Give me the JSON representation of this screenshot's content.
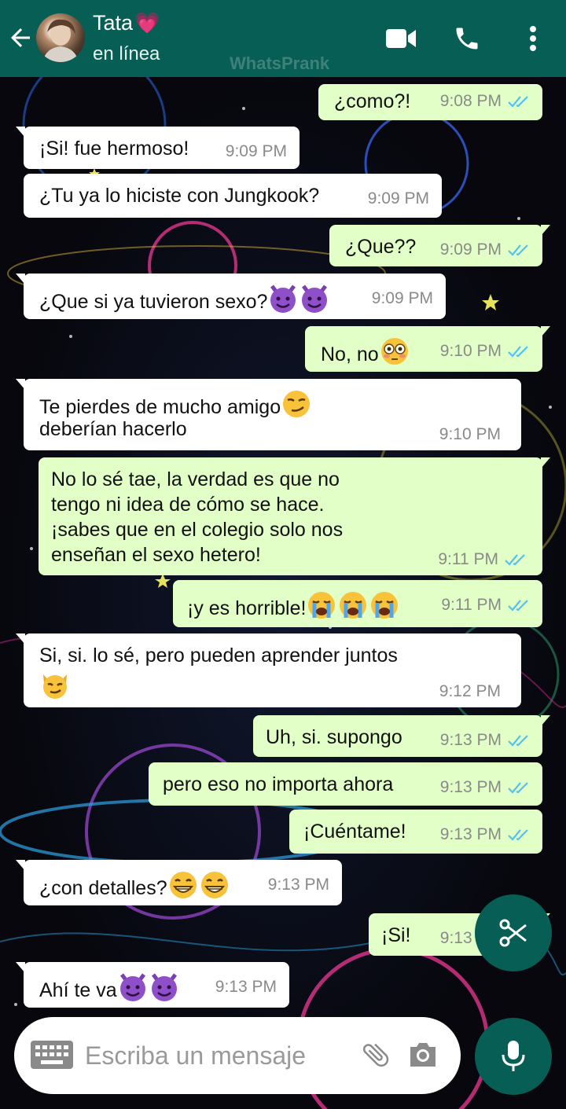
{
  "header": {
    "contact_name": "Tata",
    "status": "en línea",
    "watermark": "WhatsPrank"
  },
  "messages": [
    {
      "dir": "out",
      "text": "¿como?!",
      "time": "9:08 PM",
      "read": true
    },
    {
      "dir": "in",
      "text": "¡Si! fue hermoso!",
      "time": "9:09 PM"
    },
    {
      "dir": "in",
      "text": "¿Tu ya lo hiciste con Jungkook?",
      "time": "9:09 PM"
    },
    {
      "dir": "out",
      "text": "¿Que??",
      "time": "9:09 PM",
      "read": true
    },
    {
      "dir": "in",
      "text": "¿Que si ya tuvieron sexo?",
      "emojis": [
        "smiling-imp",
        "smiling-imp"
      ],
      "time": "9:09 PM"
    },
    {
      "dir": "out",
      "text": "No, no",
      "emojis": [
        "flushed"
      ],
      "time": "9:10 PM",
      "read": true
    },
    {
      "dir": "in",
      "text": "Te pierdes de mucho amigo",
      "text2": "deberían hacerlo",
      "emojis": [
        "smirk"
      ],
      "time": "9:10 PM"
    },
    {
      "dir": "out",
      "line1": "No lo sé tae, la verdad es que no",
      "line2": "tengo ni idea de cómo se hace.",
      "line3": "¡sabes que en el colegio solo nos",
      "line4": "enseñan el sexo hetero!",
      "time": "9:11 PM",
      "read": true
    },
    {
      "dir": "out",
      "text": "¡y es horrible!",
      "emojis": [
        "sob",
        "sob",
        "sob"
      ],
      "time": "9:11 PM",
      "read": true
    },
    {
      "dir": "in",
      "text": "Si, si. lo sé, pero pueden aprender juntos",
      "emojis": [
        "smirk-cat"
      ],
      "time": "9:12 PM"
    },
    {
      "dir": "out",
      "text": "Uh, si. supongo",
      "time": "9:13 PM",
      "read": true
    },
    {
      "dir": "out",
      "text": "pero eso no importa ahora",
      "time": "9:13 PM",
      "read": true
    },
    {
      "dir": "out",
      "text": "¡Cuéntame!",
      "time": "9:13 PM",
      "read": true
    },
    {
      "dir": "in",
      "text": "¿con detalles?",
      "emojis": [
        "grin",
        "grin"
      ],
      "time": "9:13 PM"
    },
    {
      "dir": "out",
      "text": "¡Si!",
      "time": "9:13 PM",
      "read": true
    },
    {
      "dir": "in",
      "text": "Ahí te va",
      "emojis": [
        "smiling-imp",
        "smiling-imp"
      ],
      "time": "9:13 PM"
    }
  ],
  "input": {
    "placeholder": "Escriba un mensaje"
  },
  "colors": {
    "header": "#075e54",
    "incoming_bubble": "#ffffff",
    "outgoing_bubble": "#e2ffc7",
    "read_ticks": "#4fc3f7"
  },
  "icons": [
    "back-arrow-icon",
    "video-call-icon",
    "phone-icon",
    "more-vert-icon",
    "keyboard-icon",
    "attach-icon",
    "camera-icon",
    "mic-icon",
    "scissors-icon",
    "double-check-icon"
  ]
}
